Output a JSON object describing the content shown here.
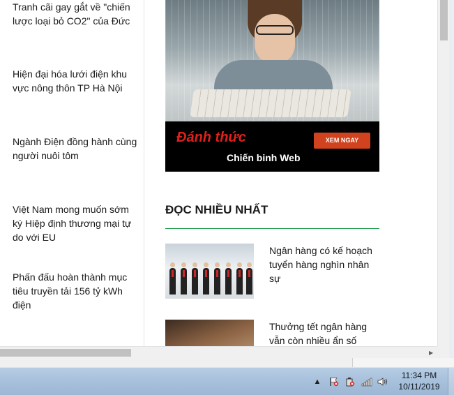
{
  "left_news": [
    "Tranh cãi gay gắt về \"chiến lược loại bỏ CO2\" của Đức",
    "Hiện đại hóa lưới điện khu vực nông thôn TP Hà Nội",
    "Ngành Điện đồng hành cùng người nuôi tôm",
    "Việt Nam mong muốn sớm ký Hiệp định thương mại tự do với EU",
    "Phấn đấu hoàn thành mục tiêu truyền tải 156 tỷ kWh điện"
  ],
  "ad": {
    "headline": "Đánh thức",
    "subline": "Chiến binh Web",
    "cta": "XEM NGAY"
  },
  "most_read": {
    "title": "ĐỌC NHIỀU NHẤT",
    "accent_color": "#1a9a4a",
    "items": [
      "Ngân hàng có kế hoạch tuyển hàng nghìn nhân sự",
      "Thưởng tết ngân hàng vẫn còn nhiều ẩn số"
    ]
  },
  "taskbar": {
    "time": "11:34 PM",
    "date": "10/11/2019",
    "tray_icons": [
      "show-hidden-icons",
      "action-center-flag-icon",
      "power-icon",
      "network-signal-icon",
      "volume-icon"
    ]
  }
}
